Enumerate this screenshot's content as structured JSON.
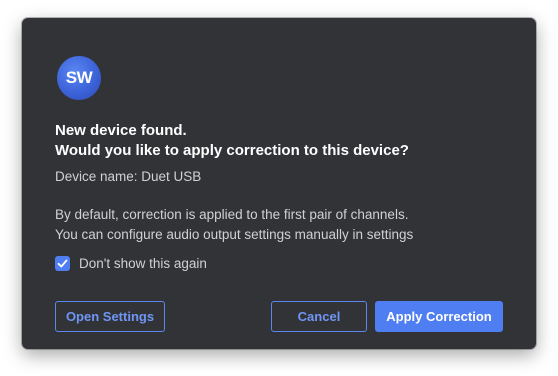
{
  "dialog": {
    "logo_text": "SW",
    "headline_line1": "New device found.",
    "headline_line2": "Would you like to apply correction to this device?",
    "device_name": "Device name: Duet USB",
    "info_line1": "By default, correction is applied to the first pair of channels.",
    "info_line2": "You can configure audio output settings manually in settings",
    "checkbox": {
      "label": "Don't show this again",
      "checked": true
    },
    "buttons": {
      "open_settings": "Open Settings",
      "cancel": "Cancel",
      "apply": "Apply Correction"
    }
  },
  "colors": {
    "accent": "#4f7ef2",
    "dialog_background": "#323337"
  },
  "icons": {
    "logo": "sw-logo-icon",
    "checkbox": "checkmark-icon"
  }
}
